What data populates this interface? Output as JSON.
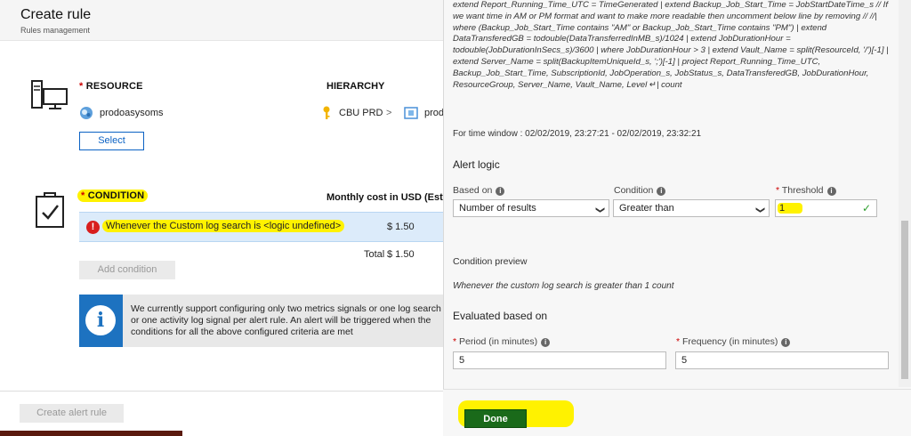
{
  "header": {
    "title": "Create rule",
    "subtitle": "Rules management"
  },
  "resource": {
    "label": "RESOURCE",
    "hierarchy_label": "HIERARCHY",
    "name": "prodoasysoms",
    "hierarchy_root": "CBU PRD",
    "hierarchy_sep": ">",
    "hierarchy_child": "prod",
    "select_label": "Select"
  },
  "condition": {
    "label": "CONDITION",
    "cost_label": "Monthly cost in USD (Estim",
    "row_text": "Whenever the Custom log search is <logic undefined>",
    "row_cost": "$ 1.50",
    "total_label": "Total",
    "total_value": "$ 1.50",
    "add_label": "Add condition",
    "error_glyph": "!"
  },
  "info": {
    "glyph": "i",
    "text": "We currently support configuring only two metrics signals or one log search or one activity log signal per alert rule. An alert will be triggered when the conditions for all the above configured criteria are met"
  },
  "footer": {
    "create_label": "Create alert rule"
  },
  "panel": {
    "query": "extend Report_Running_Time_UTC = TimeGenerated | extend Backup_Job_Start_Time = JobStartDateTime_s  // If we want time in AM or PM format and want to make more readable then uncomment below line by removing //  //| where (Backup_Job_Start_Time contains \"AM\" or Backup_Job_Start_Time contains \"PM\")  | extend DataTransferedGB = todouble(DataTransferredInMB_s)/1024 | extend JobDurationHour = todouble(JobDurationInSecs_s)/3600 | where JobDurationHour > 3 | extend Vault_Name = split(ResourceId, '/')[-1] | extend Server_Name = split(BackupItemUniqueId_s, ';')[-1] | project Report_Running_Time_UTC, Backup_Job_Start_Time, SubscriptionId, JobOperation_s, JobStatus_s, DataTransferedGB, JobDurationHour, ResourceGroup, Server_Name, Vault_Name, Level ↵| count",
    "time_window": "For time window : 02/02/2019, 23:27:21 - 02/02/2019, 23:32:21",
    "alert_logic": "Alert logic",
    "based_on_label": "Based on",
    "based_on_value": "Number of results",
    "condition_label": "Condition",
    "condition_value": "Greater than",
    "threshold_label": "Threshold",
    "threshold_value": "1",
    "preview_label": "Condition preview",
    "preview_text": "Whenever the custom log search is greater than 1 count",
    "evaluated_label": "Evaluated based on",
    "period_label": "Period (in minutes)",
    "period_value": "5",
    "frequency_label": "Frequency (in minutes)",
    "frequency_value": "5",
    "done_label": "Done",
    "info_glyph": "i",
    "chevron": "❯",
    "check": "✓"
  },
  "colors": {
    "accent": "#0b62c4",
    "highlight": "#fff200",
    "error": "#d81e1e",
    "done": "#1a6a1a"
  }
}
